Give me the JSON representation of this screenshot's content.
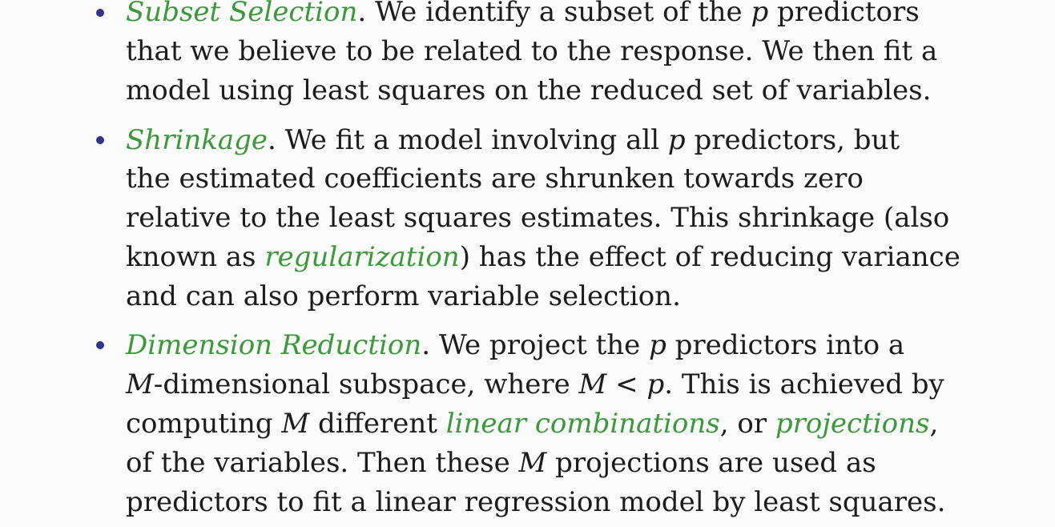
{
  "colors": {
    "bullet": "#33338c",
    "term": "#3a9a3a",
    "text": "#1c1c1c",
    "background": "#fbfbfb"
  },
  "items": [
    {
      "term": "Subset Selection",
      "lines": [
        {
          "before": ". We identify a subset of the ",
          "math": "p",
          "after": " predictors"
        },
        {
          "text": "that we believe to be related to the response. We then fit a"
        },
        {
          "text": "model using least squares on the reduced set of variables."
        }
      ]
    },
    {
      "term": "Shrinkage",
      "lines": [
        {
          "before": ". We fit a model involving all ",
          "math": "p",
          "after": " predictors, but"
        },
        {
          "text": "the estimated coefficients are shrunken towards zero"
        },
        {
          "text": "relative to the least squares estimates. This shrinkage (also"
        },
        {
          "before": "known as ",
          "term": "regularization",
          "after": ") has the effect of reducing variance"
        },
        {
          "text": "and can also perform variable selection."
        }
      ]
    },
    {
      "term": "Dimension Reduction",
      "lines": [
        {
          "before": ". We project the ",
          "math": "p",
          "after": " predictors into a"
        },
        {
          "math1": "M",
          "mid1": "-dimensional subspace, where ",
          "math2": "M < p",
          "end": ". This is achieved by"
        },
        {
          "before": "computing ",
          "math": "M",
          "mid": " different ",
          "term1": "linear combinations",
          "mid2": ", or ",
          "term2": "projections",
          "end": ","
        },
        {
          "before": "of the variables. Then these ",
          "math": "M",
          "after": " projections are used as"
        },
        {
          "text": "predictors to fit a linear regression model by least squares."
        }
      ]
    }
  ]
}
